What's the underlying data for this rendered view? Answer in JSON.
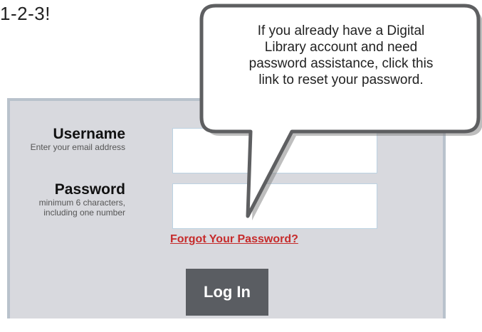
{
  "heading": "1-2-3!",
  "username": {
    "label": "Username",
    "hint": "Enter your email address",
    "value": ""
  },
  "password": {
    "label": "Password",
    "hint_line1": "minimum 6 characters,",
    "hint_line2": "including one number",
    "value": ""
  },
  "forgot_link": "Forgot Your Password?",
  "login_button": "Log In",
  "callout": {
    "line1": "If you already have a Digital",
    "line2": "Library account and need",
    "line3": "password assistance, click this",
    "line4": "link to reset your password."
  }
}
